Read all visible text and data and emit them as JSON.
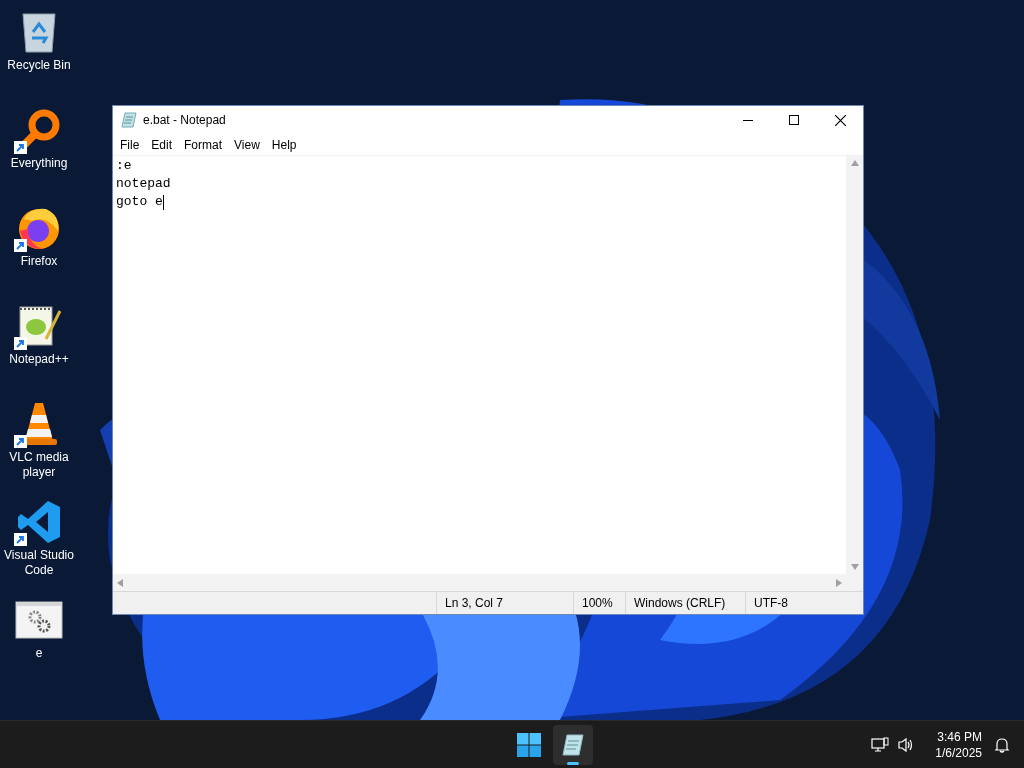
{
  "desktop_icons": [
    {
      "label": "Recycle Bin",
      "kind": "recycle",
      "shortcut": false
    },
    {
      "label": "Everything",
      "kind": "search",
      "shortcut": true
    },
    {
      "label": "Firefox",
      "kind": "firefox",
      "shortcut": true
    },
    {
      "label": "Notepad++",
      "kind": "notepadpp",
      "shortcut": true
    },
    {
      "label": "VLC media player",
      "kind": "vlc",
      "shortcut": true
    },
    {
      "label": "Visual Studio Code",
      "kind": "vscode",
      "shortcut": true
    },
    {
      "label": "e",
      "kind": "batch",
      "shortcut": false
    }
  ],
  "window": {
    "title": "e.bat - Notepad",
    "menu": [
      "File",
      "Edit",
      "Format",
      "View",
      "Help"
    ],
    "lines": [
      ":e",
      "notepad",
      "goto e"
    ],
    "status_bar": [
      "Ln 3, Col 7",
      "100%",
      "Windows (CRLF)",
      "UTF-8"
    ]
  },
  "taskbar": {
    "apps": [
      {
        "kind": "start",
        "active": false
      },
      {
        "kind": "notepad",
        "active": true
      }
    ],
    "time": "3:46 PM",
    "date": "1/6/2025"
  }
}
